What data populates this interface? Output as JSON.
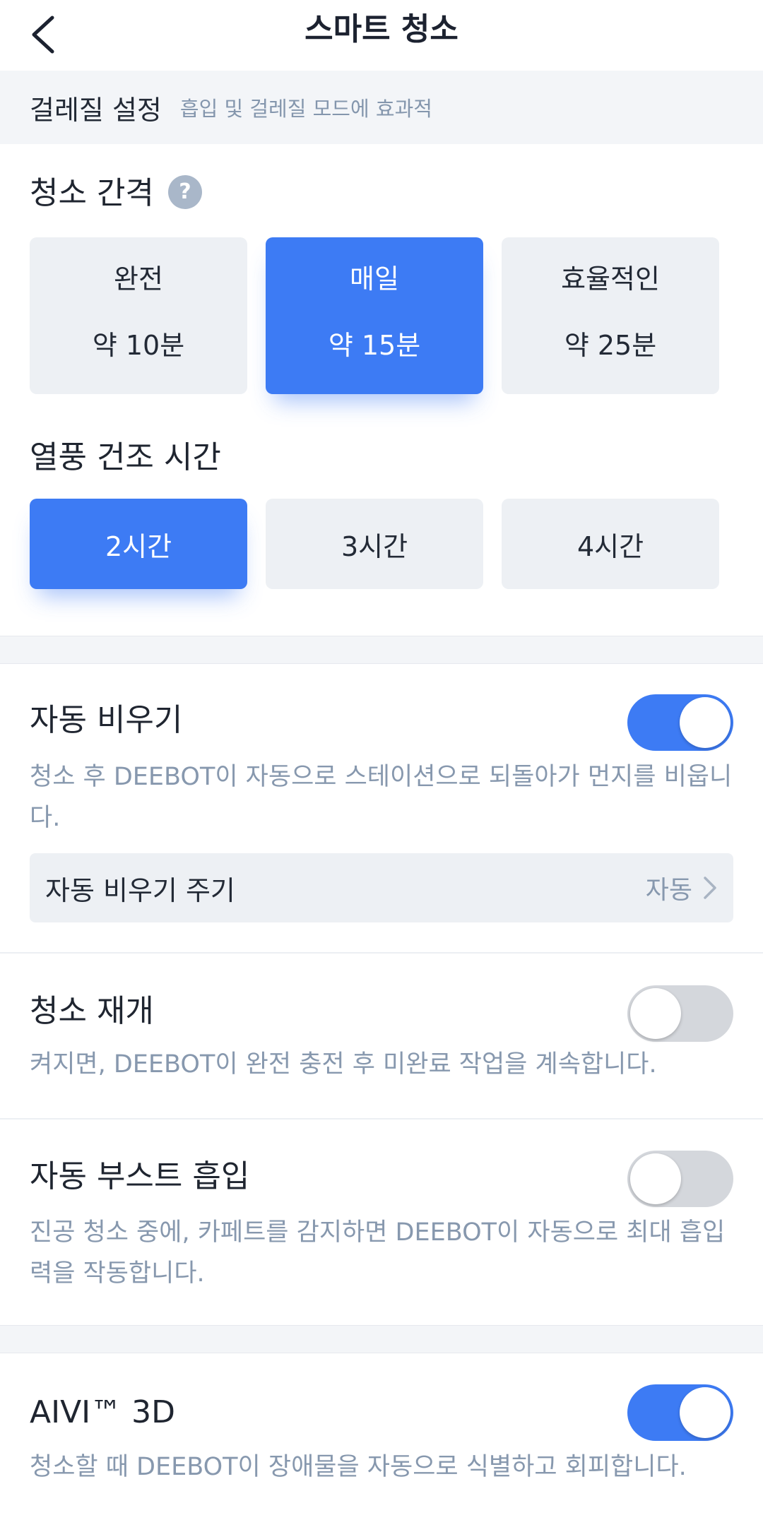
{
  "header": {
    "title": "스마트 청소"
  },
  "mop_settings": {
    "title": "걸레질 설정",
    "description": "흡입 및 걸레질 모드에 효과적"
  },
  "cleaning_interval": {
    "title": "청소 간격",
    "help": "?",
    "options": [
      {
        "label": "완전",
        "duration": "약 10분",
        "selected": false
      },
      {
        "label": "매일",
        "duration": "약 15분",
        "selected": true
      },
      {
        "label": "효율적인",
        "duration": "약 25분",
        "selected": false
      }
    ]
  },
  "hot_air_drying": {
    "title": "열풍 건조 시간",
    "options": [
      {
        "label": "2시간",
        "selected": true
      },
      {
        "label": "3시간",
        "selected": false
      },
      {
        "label": "4시간",
        "selected": false
      }
    ]
  },
  "auto_empty": {
    "title": "자동 비우기",
    "description": "청소 후 DEEBOT이 자동으로 스테이션으로 되돌아가 먼지를 비웁니다.",
    "enabled": true,
    "frequency": {
      "label": "자동 비우기 주기",
      "value": "자동"
    }
  },
  "resume_cleaning": {
    "title": "청소 재개",
    "description": "켜지면, DEEBOT이 완전 충전 후 미완료 작업을 계속합니다.",
    "enabled": false
  },
  "auto_boost": {
    "title": "자동 부스트 흡입",
    "description": "진공 청소 중에, 카페트를 감지하면 DEEBOT이 자동으로 최대 흡입력을 작동합니다.",
    "enabled": false
  },
  "aivi": {
    "title": "AIVI™ 3D",
    "description": "청소할 때 DEEBOT이 장애물을 자동으로 식별하고 회피합니다.",
    "enabled": true
  },
  "colors": {
    "accent": "#3d7bf4",
    "card_bg": "#edf0f4",
    "muted_text": "#8798ae"
  }
}
